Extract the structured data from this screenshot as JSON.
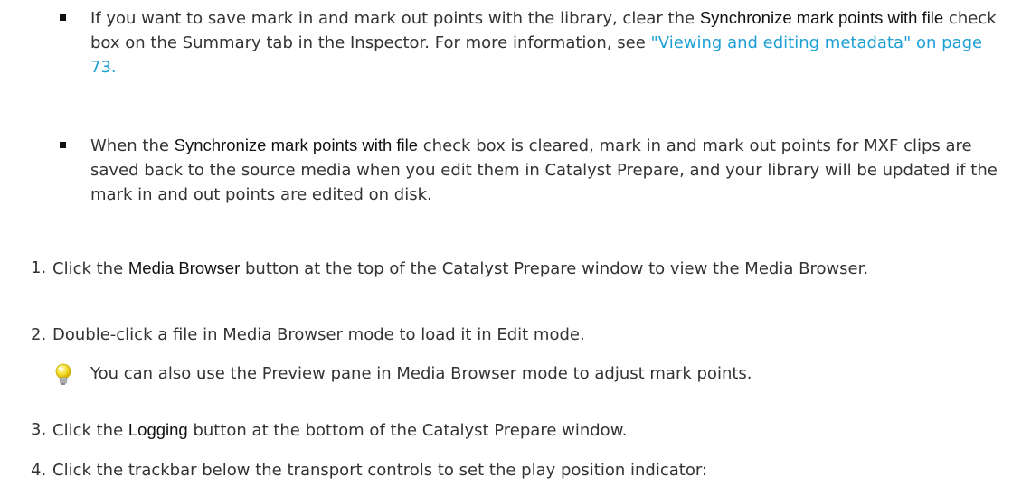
{
  "bullets": [
    {
      "t1": "If you want to save mark in and mark out points with the library, clear the ",
      "b1": "Synchronize mark points with file",
      "t2": " check box on the Summary tab in the Inspector. For more information, see ",
      "link": "\"Viewing and editing metadata\" on page 73."
    },
    {
      "t1": "When the ",
      "b1": "Synchronize mark points with file",
      "t2": " check box is cleared, mark in and mark out points for MXF clips are saved back to the source media when you edit them in Catalyst Prepare, and your library will be updated if the mark in and out points are edited on disk."
    }
  ],
  "steps": [
    {
      "num": "1.",
      "t1": "Click the ",
      "b1": "Media Browser",
      "t2": " button at the top of the Catalyst Prepare window to view the Media Browser."
    },
    {
      "num": "2.",
      "t1": "Double-click a file in Media Browser mode to load it in Edit mode."
    },
    {
      "num": "3.",
      "t1": "Click the ",
      "b1": "Logging",
      "t2": " button at the bottom of the Catalyst Prepare window."
    },
    {
      "num": "4.",
      "t1": "Click the trackbar below the transport controls to set the play position indicator:"
    }
  ],
  "tip": {
    "icon": "lightbulb-icon",
    "text": "You can also use the Preview pane in Media Browser mode to adjust mark points."
  },
  "colors": {
    "text": "#333333",
    "ui_label": "#111111",
    "link": "#1ea0d6"
  }
}
